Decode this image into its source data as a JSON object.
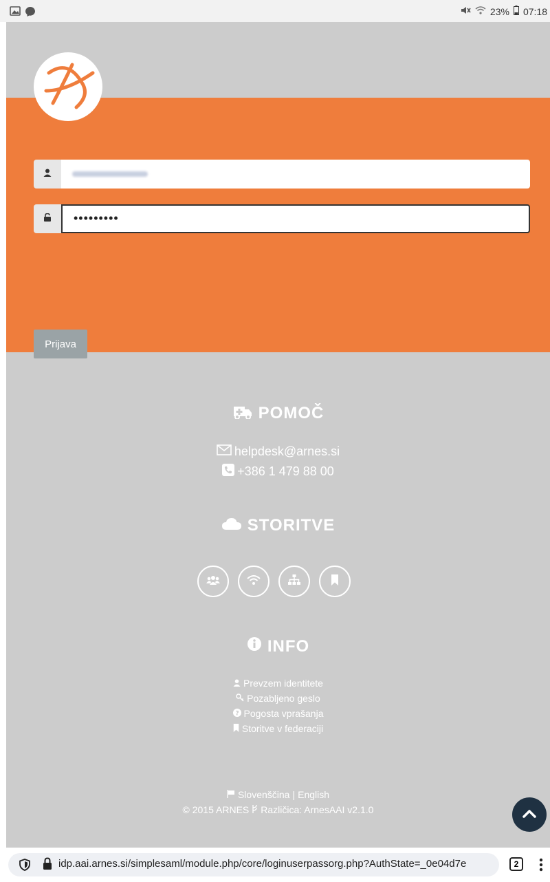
{
  "status_bar": {
    "left_icons": [
      "gallery-icon",
      "messenger-icon"
    ],
    "right_icons": [
      "mute-icon",
      "wifi-icon",
      "battery-icon"
    ],
    "battery": "23%",
    "time": "07:18"
  },
  "login": {
    "username_icon": "user-icon",
    "password_icon": "unlock-icon",
    "password_value": "•••••••••",
    "submit_label": "Prijava"
  },
  "help": {
    "icon": "ambulance-icon",
    "title": "POMOČ",
    "email": "helpdesk@arnes.si",
    "phone": "+386 1 479 88 00"
  },
  "services": {
    "icon": "cloud-icon",
    "title": "STORITVE",
    "items": [
      "group-icon",
      "wifi-icon",
      "network-icon",
      "bookmark-icon"
    ]
  },
  "info": {
    "icon": "info-circle-icon",
    "title": "INFO",
    "links": [
      {
        "icon": "user-icon",
        "label": "Prevzem identitete"
      },
      {
        "icon": "key-icon",
        "label": "Pozabljeno geslo"
      },
      {
        "icon": "question-icon",
        "label": "Pogosta vprašanja"
      },
      {
        "icon": "bookmark-icon",
        "label": "Storitve v federaciji"
      }
    ]
  },
  "footer": {
    "lang_icon": "flag-icon",
    "lang_current": "Slovenščina",
    "separator": "|",
    "lang_other": "English",
    "copyright": "© 2015 ARNES",
    "version": "Različica: ArnesAAI v2.1.0"
  },
  "browser": {
    "url": "idp.aai.arnes.si/simplesaml/module.php/core/loginuserpassorg.php?AuthState=_0e04d7e",
    "tab_count": "2"
  },
  "colors": {
    "brand_orange": "#ef7d3c",
    "page_gray": "#cccccc",
    "button_gray": "#9aa3a6",
    "scroll_button": "#1f3142"
  }
}
